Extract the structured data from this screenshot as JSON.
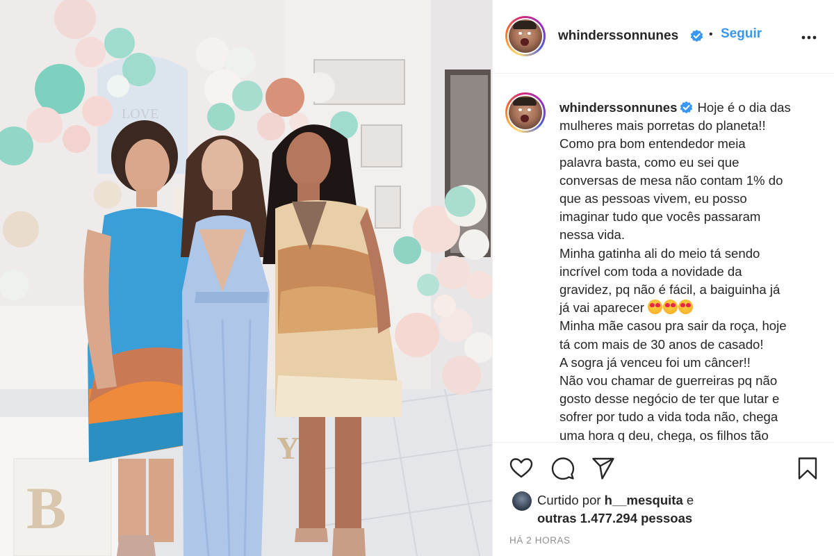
{
  "post": {
    "username": "whinderssonnunes",
    "separator": "•",
    "follow_label": "Seguir",
    "more_icon": "more-horizontal-icon",
    "verified_icon": "verified-badge-icon",
    "caption_user": "whinderssonnunes",
    "caption_lines": [
      "Hoje é o dia das",
      "mulheres mais porretas do planeta!!",
      "Como pra bom entendedor meia",
      "palavra basta, como eu sei que",
      "conversas de mesa não contam 1% do",
      "que as pessoas vivem, eu posso",
      "imaginar tudo que vocês passaram",
      "nessa vida.",
      "Minha gatinha ali do meio tá sendo",
      "incrível com toda a novidade da",
      "gravidez, pq não é fácil, a baiguinha já",
      "já vai aparecer",
      "Minha mãe casou pra sair da roça, hoje",
      "tá com mais de 30 anos de casado!",
      "A sogra já venceu foi um câncer!!",
      "Não vou chamar de guerreiras pq não",
      "gosto desse negócio de ter que lutar e",
      "sofrer por tudo a vida toda não, chega",
      "uma hora q deu, chega, os filhos tão"
    ],
    "emoji_count": 3,
    "emoji_name": "heart-eyes-emoji",
    "likes_prefix": "Curtido por",
    "likes_user": "h__mesquita",
    "likes_joiner": "e",
    "likes_others": "outras 1.477.294 pessoas",
    "timestamp": "HÁ 2 HORAS"
  },
  "actions": {
    "like_icon": "heart-icon",
    "comment_icon": "comment-icon",
    "share_icon": "share-icon",
    "save_icon": "bookmark-icon"
  },
  "photo": {
    "description_icon": "post-photo",
    "letters": [
      "LOVE",
      "B",
      "Y"
    ]
  },
  "colors": {
    "accent": "#3897f0",
    "verified": "#3897f0",
    "text": "#262626",
    "muted": "#8e8e8e",
    "divider": "#efefef"
  }
}
